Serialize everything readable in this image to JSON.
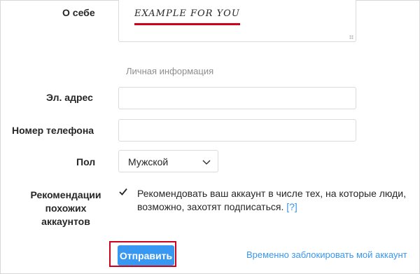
{
  "bio": {
    "label": "О себе",
    "value": "EXAMPLE FOR YOU"
  },
  "personal_info": {
    "section_title": "Личная информация"
  },
  "email": {
    "label": "Эл. адрес",
    "value": ""
  },
  "phone": {
    "label": "Номер телефона",
    "value": ""
  },
  "gender": {
    "label": "Пол",
    "selected": "Мужской"
  },
  "recommendations": {
    "label_line1": "Рекомендации",
    "label_line2": "похожих",
    "label_line3": "аккаунтов",
    "checked": true,
    "text": "Рекомендовать ваш аккаунт в числе тех, на которые люди, возможно, захотят подписаться.",
    "help": "[?]"
  },
  "actions": {
    "submit": "Отправить",
    "disable_account": "Временно заблокировать мой аккаунт"
  },
  "colors": {
    "accent": "#3897f0",
    "highlight": "#d0021b"
  }
}
